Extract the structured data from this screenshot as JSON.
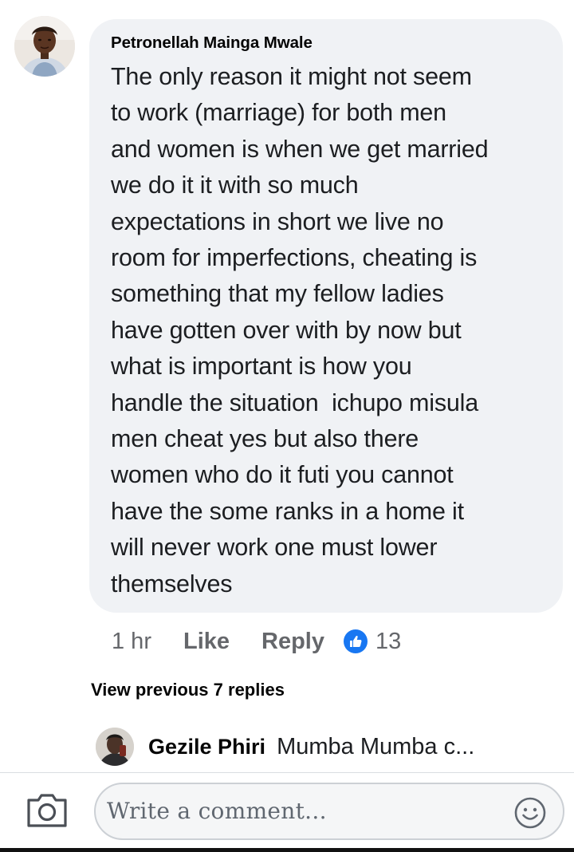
{
  "comment": {
    "author": "Petronellah Mainga Mwale",
    "lines": [
      "The only reason it might not seem",
      "to work (marriage) for both men",
      "and women is when we get married",
      "we do it it with so much",
      "expectations in short we live no",
      "room for imperfections, cheating is",
      "something that my fellow ladies",
      "have gotten over with by now but",
      "what is important is how you",
      "handle the situation  ichupo misula",
      "men cheat yes but also there",
      "women who do it futi you cannot",
      "have the some ranks in a home it",
      "will never work one must lower",
      "themselves"
    ],
    "time": "1 hr",
    "like_label": "Like",
    "reply_label": "Reply",
    "reaction_count": "13",
    "reaction_icon": "thumbs-up-icon"
  },
  "view_previous": "View previous 7 replies",
  "latest_reply": {
    "author": "Gezile Phiri",
    "snippet": "Mumba Mumba c..."
  },
  "composer": {
    "placeholder": "Write a comment..."
  },
  "colors": {
    "bubble": "#f0f2f5",
    "like_blue": "#1877f2",
    "secondary_text": "#65676b"
  }
}
